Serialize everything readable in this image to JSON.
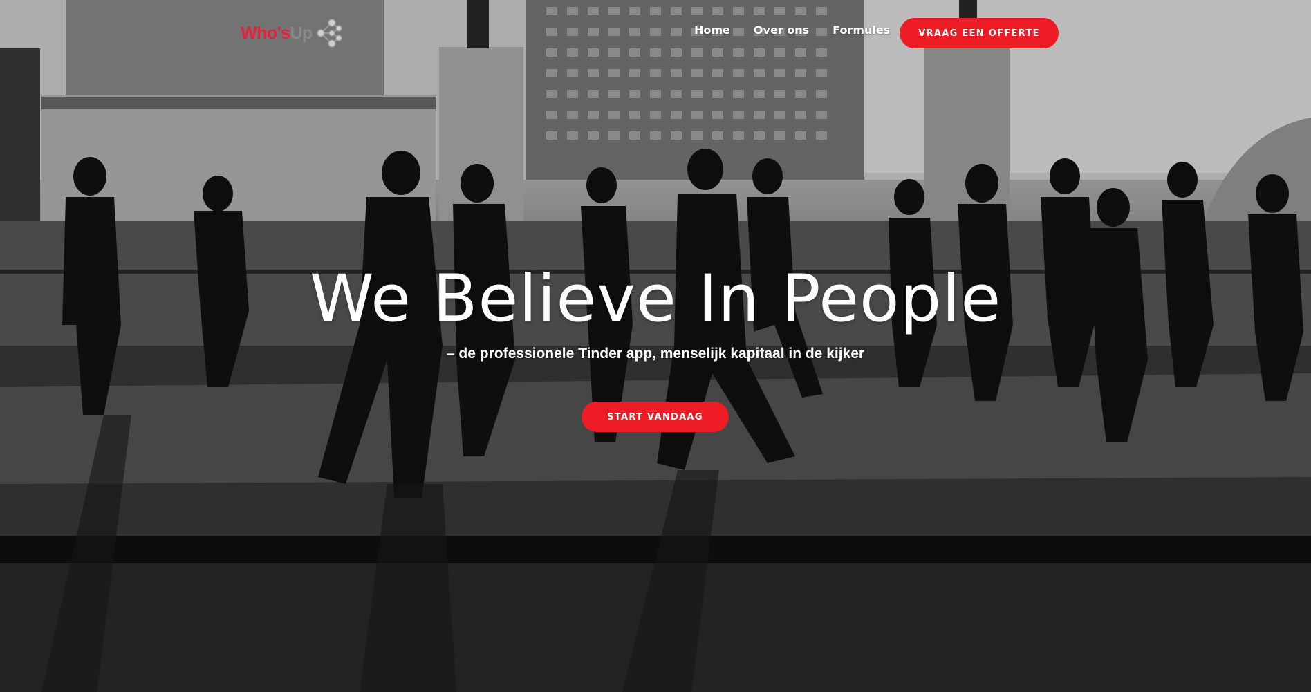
{
  "header": {
    "logo": {
      "text_primary": "Who's",
      "text_secondary": "Up",
      "icon": "molecule-nodes-icon"
    },
    "nav": [
      {
        "label": "Home"
      },
      {
        "label": "Over ons"
      },
      {
        "label": "Formules"
      }
    ],
    "cta_label": "VRAAG EEN OFFERTE"
  },
  "hero": {
    "title": "We Believe In People",
    "subtitle": "– de professionele Tinder app, menselijk kapitaal in de kijker",
    "cta_label": "START VANDAAG",
    "background": "black-and-white-crowd-walking-photo"
  },
  "colors": {
    "brand_red": "#ee1c25",
    "logo_red": "#e8213a",
    "logo_grey": "#8a8a8a",
    "text_white": "#ffffff"
  }
}
